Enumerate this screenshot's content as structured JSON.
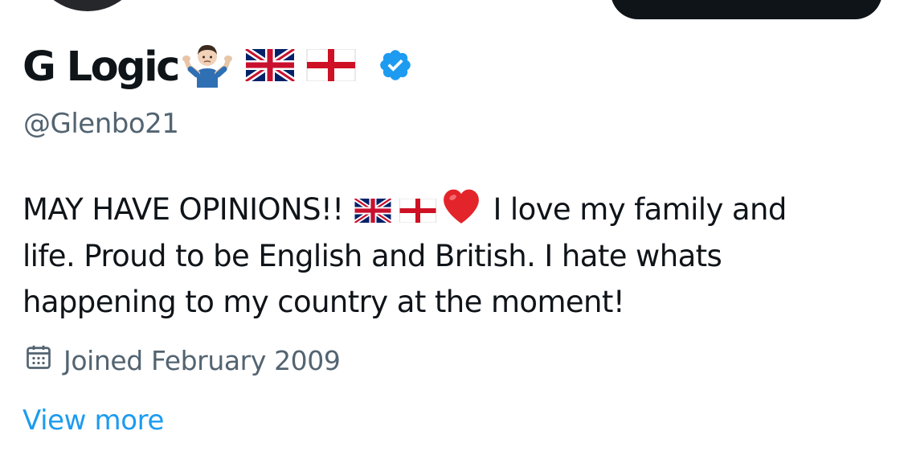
{
  "profile": {
    "display_name": "G Logic",
    "handle": "@Glenbo21",
    "name_emojis": [
      "person-shrugging-emoji",
      "flag-united-kingdom-emoji",
      "flag-england-emoji",
      "verified-badge-icon"
    ],
    "bio": {
      "line1_start": "MAY HAVE OPINIONS!!",
      "line1_end": "I love my family and",
      "line2": "life. Proud to be English and British. I hate whats",
      "line3": "happening to my country at the moment!",
      "emojis": [
        "flag-united-kingdom-emoji",
        "flag-england-emoji",
        "red-heart-emoji"
      ]
    },
    "joined": "Joined February 2009",
    "joined_icon": "calendar-icon",
    "view_more": "View more"
  },
  "colors": {
    "text_primary": "#0f1419",
    "text_secondary": "#536471",
    "link": "#1d9bf0",
    "verified": "#1d9bf0",
    "background": "#ffffff"
  }
}
